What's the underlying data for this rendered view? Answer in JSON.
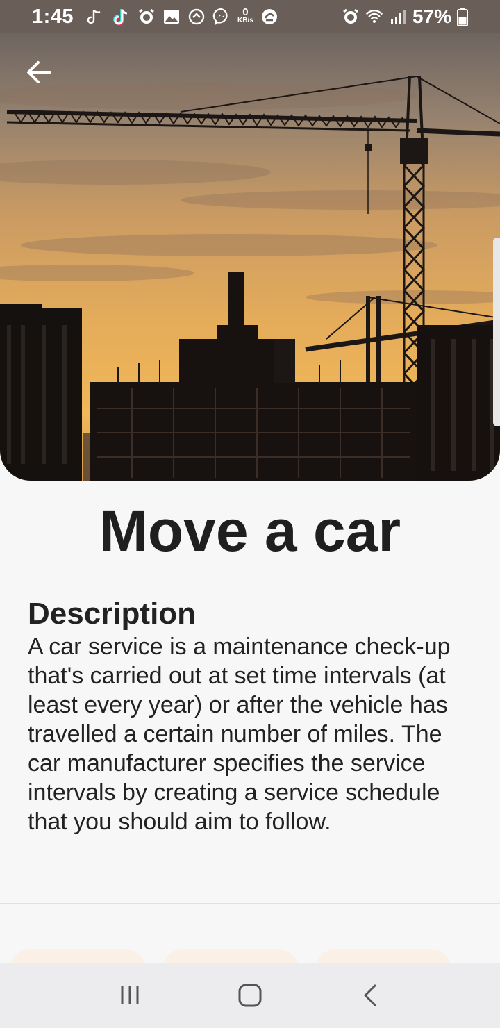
{
  "status_bar": {
    "time": "1:45",
    "battery": "57%",
    "icons": [
      "tiktok-music-icon",
      "tiktok-icon",
      "alarm-icon",
      "gallery-icon",
      "circle-icon",
      "messenger-icon",
      "data-speed-icon",
      "sync-icon",
      "alarm-icon",
      "wifi-icon",
      "signal-icon",
      "battery-icon"
    ],
    "speed_value": "0",
    "speed_unit": "KB/s"
  },
  "header": {
    "back_icon": "arrow-left-icon"
  },
  "main": {
    "title": "Move a car",
    "description_heading": "Description",
    "description_body": "A car service is a maintenance check-up that's carried out at set time intervals (at least every year) or after the vehicle has travelled a certain number of miles. The car manufacturer specifies the service intervals by creating a service schedule that you should aim to follow."
  },
  "nav_bar": {
    "recents_icon": "recents-icon",
    "home_icon": "home-icon",
    "back_icon": "back-chevron-icon"
  },
  "colors": {
    "status_bar_bg": "#6a5f58",
    "page_bg": "#f7f7f8",
    "card_peek": "#fbf0e6",
    "nav_bg": "#ececee"
  }
}
